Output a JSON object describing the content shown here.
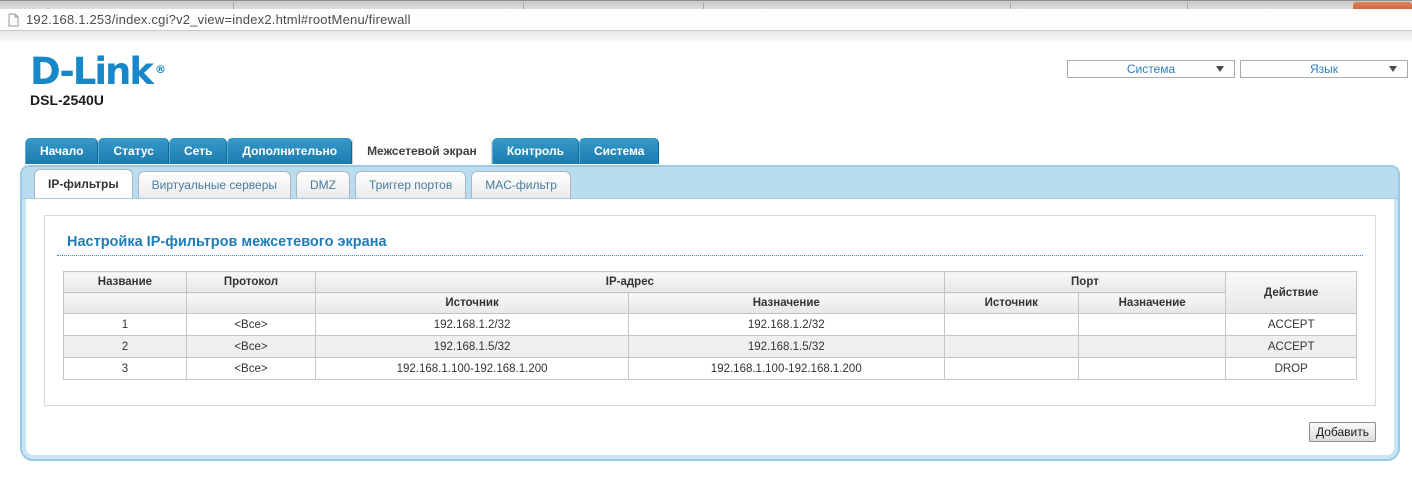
{
  "browser": {
    "url": "192.168.1.253/index.cgi?v2_view=index2.html#rootMenu/firewall"
  },
  "brand": {
    "logo": "D-Link",
    "registered_mark": "®",
    "model": "DSL-2540U"
  },
  "top_menus": [
    {
      "label": "Система"
    },
    {
      "label": "Язык"
    }
  ],
  "nav_tabs": [
    {
      "label": "Начало",
      "active": false
    },
    {
      "label": "Статус",
      "active": false
    },
    {
      "label": "Сеть",
      "active": false
    },
    {
      "label": "Дополнительно",
      "active": false
    },
    {
      "label": "Межсетевой экран",
      "active": true
    },
    {
      "label": "Контроль",
      "active": false
    },
    {
      "label": "Система",
      "active": false
    }
  ],
  "sub_tabs": [
    {
      "label": "IP-фильтры",
      "active": true
    },
    {
      "label": "Виртуальные серверы",
      "active": false
    },
    {
      "label": "DMZ",
      "active": false
    },
    {
      "label": "Триггер портов",
      "active": false
    },
    {
      "label": "MAC-фильтр",
      "active": false
    }
  ],
  "content": {
    "heading": "Настройка IP-фильтров межсетевого экрана",
    "add_button_label": "Добавить"
  },
  "table": {
    "headers": {
      "name": "Название",
      "protocol": "Протокол",
      "ip": "IP-адрес",
      "port": "Порт",
      "action": "Действие",
      "source": "Источник",
      "destination": "Назначение"
    },
    "rows": [
      {
        "name": "1",
        "protocol": "<Все>",
        "ip_source": "192.168.1.2/32",
        "ip_destination": "192.168.1.2/32",
        "port_source": "",
        "port_destination": "",
        "action": "ACCEPT"
      },
      {
        "name": "2",
        "protocol": "<Все>",
        "ip_source": "192.168.1.5/32",
        "ip_destination": "192.168.1.5/32",
        "port_source": "",
        "port_destination": "",
        "action": "ACCEPT"
      },
      {
        "name": "3",
        "protocol": "<Все>",
        "ip_source": "192.168.1.100-192.168.1.200",
        "ip_destination": "192.168.1.100-192.168.1.200",
        "port_source": "",
        "port_destination": "",
        "action": "DROP"
      }
    ]
  },
  "colors": {
    "brand_blue": "#1687c9",
    "nav_tab_blue": "#1e86bb",
    "band_blue": "#badcef",
    "panel_border_blue": "#9ccae6",
    "heading_blue": "#1a7cb8",
    "close_button_orange": "#cd6440"
  }
}
